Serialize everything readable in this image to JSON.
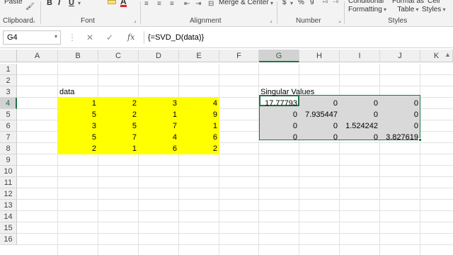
{
  "ribbon": {
    "groups": {
      "clipboard": "Clipboard",
      "font": "Font",
      "alignment": "Alignment",
      "number": "Number",
      "styles": "Styles"
    },
    "paste_label": "Paste",
    "bold": "B",
    "italic": "I",
    "underline": "U",
    "merge_center": "Merge & Center",
    "currency": "$",
    "percent": "%",
    "comma": "9",
    "conditional_formatting": [
      "Conditional",
      "Formatting"
    ],
    "format_as_table": [
      "Format as",
      "Table"
    ],
    "cell_styles": [
      "Cell",
      "Styles"
    ]
  },
  "formula_bar": {
    "name_box": "G4",
    "formula": "{=SVD_D(data)}"
  },
  "columns": [
    "A",
    "B",
    "C",
    "D",
    "E",
    "F",
    "G",
    "H",
    "I",
    "J",
    "K"
  ],
  "rows": [
    "1",
    "2",
    "3",
    "4",
    "5",
    "6",
    "7",
    "8",
    "9",
    "10",
    "11",
    "12",
    "13",
    "14",
    "15",
    "16"
  ],
  "selected_cell": "G4",
  "labels": {
    "data": "data",
    "singular_values": "Singular Values"
  },
  "data_matrix": [
    [
      "1",
      "2",
      "3",
      "4"
    ],
    [
      "5",
      "2",
      "1",
      "9"
    ],
    [
      "3",
      "5",
      "7",
      "1"
    ],
    [
      "5",
      "7",
      "4",
      "6"
    ],
    [
      "2",
      "1",
      "6",
      "2"
    ]
  ],
  "singular_matrix": [
    [
      "17.77793",
      "0",
      "0",
      "0"
    ],
    [
      "0",
      "7.935447",
      "0",
      "0"
    ],
    [
      "0",
      "0",
      "1.524242",
      "0"
    ],
    [
      "0",
      "0",
      "0",
      "3.827619"
    ]
  ],
  "colors": {
    "accent": "#217346",
    "highlight": "#ffff00",
    "selection": "#d9d9d9"
  }
}
